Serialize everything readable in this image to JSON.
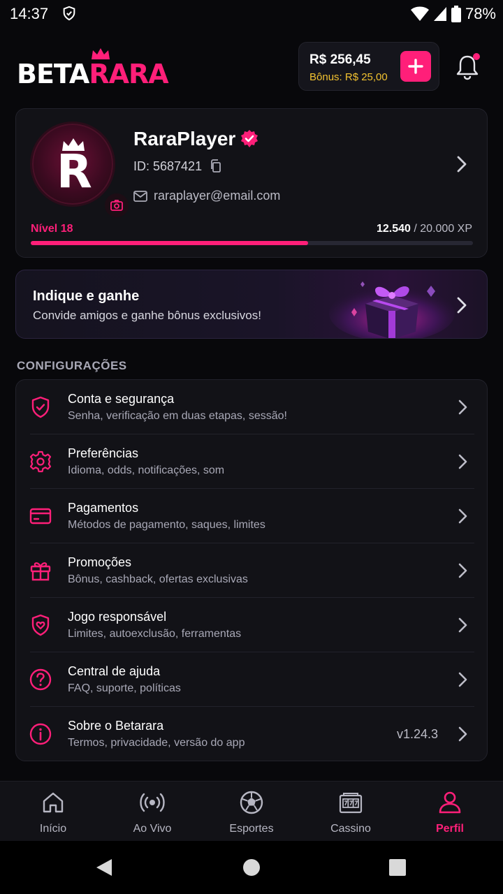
{
  "status_bar": {
    "time": "14:37",
    "battery": "78%"
  },
  "header": {
    "logo_beta": "BETA",
    "logo_rara": "RARA",
    "balance": "R$ 256,45",
    "bonus": "Bônus: R$ 25,00",
    "accent": "#ff1f79",
    "bonus_color": "#f2c230"
  },
  "profile": {
    "avatar_letter": "R",
    "username": "RaraPlayer",
    "id": "ID: 5687421",
    "email": "raraplayer@email.com",
    "level": "Nível 18",
    "xp_current": "12.540",
    "xp_total": " / 20.000 XP",
    "xp_progress": 0.627
  },
  "referral": {
    "title": "Indique e ganhe",
    "subtitle": "Convide amigos e ganhe bônus exclusivos!"
  },
  "settings": {
    "section_title": "CONFIGURAÇÕES",
    "items": [
      {
        "title": "Conta e segurança",
        "subtitle": "Senha, verificação em duas etapas, sessão!",
        "icon": "shield-check-icon"
      },
      {
        "title": "Preferências",
        "subtitle": "Idioma, odds, notificações, som",
        "icon": "gear-icon"
      },
      {
        "title": "Pagamentos",
        "subtitle": "Métodos de pagamento, saques, limites",
        "icon": "credit-card-icon"
      },
      {
        "title": "Promoções",
        "subtitle": "Bônus, cashback, ofertas exclusivas",
        "icon": "gift-icon"
      },
      {
        "title": "Jogo responsável",
        "subtitle": "Limites, autoexclusão, ferramentas",
        "icon": "shield-heart-icon"
      },
      {
        "title": "Central de ajuda",
        "subtitle": "FAQ, suporte, políticas",
        "icon": "question-circle-icon"
      },
      {
        "title": "Sobre o Betarara",
        "subtitle": "Termos, privacidade, versão do app",
        "icon": "info-circle-icon",
        "version": "v1.24.3"
      }
    ]
  },
  "bottom_nav": {
    "items": [
      {
        "label": "Início",
        "icon": "home-icon"
      },
      {
        "label": "Ao Vivo",
        "icon": "live-broadcast-icon"
      },
      {
        "label": "Esportes",
        "icon": "soccer-ball-icon"
      },
      {
        "label": "Cassino",
        "icon": "slot-machine-icon"
      },
      {
        "label": "Perfil",
        "icon": "user-icon",
        "active": true
      }
    ]
  }
}
